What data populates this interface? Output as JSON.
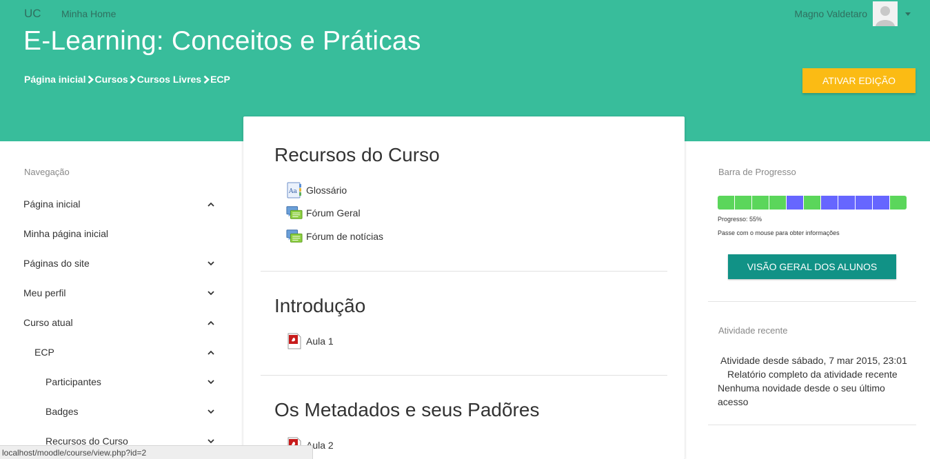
{
  "topbar": {
    "brand": "UC",
    "home_link": "Minha Home",
    "user_name": "Magno Valdetaro"
  },
  "header": {
    "title": "E-Learning: Conceitos e Práticas",
    "breadcrumb": [
      "Página inicial",
      "Cursos",
      "Cursos Livres",
      "ECP"
    ],
    "edit_button": "ATIVAR EDIÇÃO"
  },
  "navigation": {
    "title": "Navegação",
    "items": [
      {
        "label": "Página inicial",
        "chevron": "up"
      },
      {
        "label": "Minha página inicial",
        "chevron": ""
      },
      {
        "label": "Páginas do site",
        "chevron": "down"
      },
      {
        "label": "Meu perfil",
        "chevron": "down"
      },
      {
        "label": "Curso atual",
        "chevron": "up"
      },
      {
        "label": "ECP",
        "chevron": "up"
      },
      {
        "label": "Participantes",
        "chevron": "down"
      },
      {
        "label": "Badges",
        "chevron": "down"
      },
      {
        "label": "Recursos do Curso",
        "chevron": "down"
      }
    ]
  },
  "main": {
    "sections": [
      {
        "title": "Recursos do Curso",
        "activities": [
          {
            "label": "Glossário",
            "icon": "glossary-icon"
          },
          {
            "label": "Fórum Geral",
            "icon": "forum-icon"
          },
          {
            "label": "Fórum de notícias",
            "icon": "forum-icon"
          }
        ]
      },
      {
        "title": "Introdução",
        "activities": [
          {
            "label": "Aula 1",
            "icon": "pdf-icon"
          }
        ]
      },
      {
        "title": "Os Metadados e seus Padõres",
        "activities": [
          {
            "label": "Aula 2",
            "icon": "pdf-icon"
          }
        ]
      }
    ]
  },
  "progress_block": {
    "title": "Barra de Progresso",
    "progress_text": "Progresso: 55%",
    "progress_fraction": 0.55,
    "hint": "Passe com o mouse para obter informações",
    "button": "VISÃO GERAL DOS ALUNOS",
    "cells": [
      "done",
      "done",
      "done",
      "done",
      "todo",
      "done",
      "todo",
      "todo",
      "todo",
      "todo",
      "done"
    ],
    "colors": {
      "done": "#5bd65b",
      "todo": "#6666ff"
    }
  },
  "recent_block": {
    "title": "Atividade recente",
    "since": "Atividade desde sábado, 7 mar 2015, 23:01",
    "full_report": "Relatório completo da atividade recente",
    "no_news_1": "Nenhuma novidade desde o seu último",
    "no_news_2": "acesso"
  },
  "status_bar": {
    "url": "localhost/moodle/course/view.php?id=2"
  },
  "colors": {
    "header_bg": "#38bd9b",
    "edit_button": "#fbbb14",
    "overview_button": "#119286"
  }
}
